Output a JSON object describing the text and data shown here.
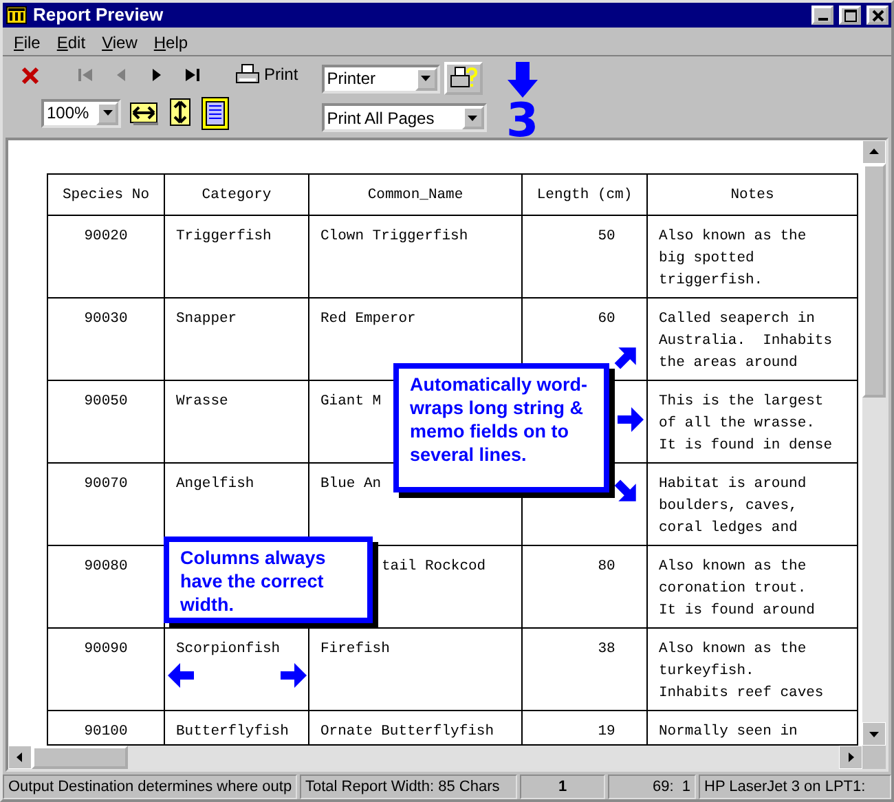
{
  "window": {
    "title": "Report Preview"
  },
  "menu": [
    "File",
    "Edit",
    "View",
    "Help"
  ],
  "toolbar": {
    "nav": [
      {
        "kind": "close",
        "disabled": false
      },
      {
        "kind": "first",
        "disabled": true
      },
      {
        "kind": "prev",
        "disabled": true
      },
      {
        "kind": "next",
        "disabled": false
      },
      {
        "kind": "last",
        "disabled": false
      }
    ],
    "print_label": "Print",
    "destination": "Printer",
    "zoom": "100%",
    "pages": "Print All Pages"
  },
  "page_marker": "3",
  "table": {
    "columns": [
      "Species No",
      "Category",
      "Common_Name",
      "Length (cm)",
      "Notes"
    ],
    "rows": [
      {
        "cells": [
          "90020",
          "Triggerfish",
          "Clown Triggerfish",
          "50",
          "Also known as the\nbig spotted\ntriggerfish."
        ]
      },
      {
        "cells": [
          "90030",
          "Snapper",
          "Red Emperor",
          "60",
          "Called seaperch in\nAustralia.  Inhabits\nthe areas around"
        ]
      },
      {
        "cells": [
          "90050",
          "Wrasse",
          "Giant M",
          null,
          "This is the largest\nof all the wrasse.\nIt is found in dense"
        ]
      },
      {
        "cells": [
          "90070",
          "Angelfish",
          "Blue An",
          null,
          "Habitat is around\nboulders, caves,\ncoral ledges and"
        ]
      },
      {
        "cells": [
          "90080",
          null,
          "tail Rockcod",
          "80",
          "Also known as the\ncoronation trout.\nIt is found around"
        ]
      },
      {
        "cells": [
          "90090",
          "Scorpionfish",
          "Firefish",
          "38",
          "Also known as the\nturkeyfish.\nInhabits reef caves"
        ]
      },
      {
        "cells": [
          "90100",
          "Butterflyfish",
          "Ornate Butterflyfish",
          "19",
          "Normally seen in"
        ]
      }
    ]
  },
  "callouts": [
    {
      "text": "Automatically word-wraps long string & memo fields on to several lines.",
      "kind": "wrap"
    },
    {
      "text": "Columns always have the correct width.",
      "kind": "columns"
    }
  ],
  "status_bar": [
    "Output Destination determines where outp",
    "Total Report Width: 85 Chars",
    "1",
    "69:  1",
    "HP LaserJet 3 on LPT1:"
  ]
}
